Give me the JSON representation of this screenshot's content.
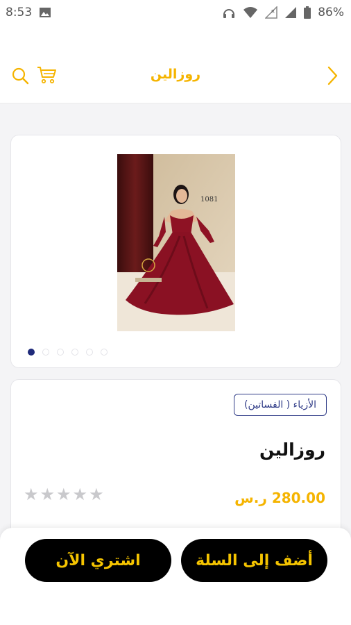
{
  "status_bar": {
    "time": "8:53",
    "battery": "86%",
    "icons": [
      "image-icon",
      "headphones-icon",
      "wifi-icon",
      "signal-r-icon",
      "signal-icon",
      "battery-icon"
    ]
  },
  "app_bar": {
    "title": "روزالين",
    "icons": [
      "search-icon",
      "cart-icon",
      "chevron-right-icon"
    ],
    "accent_color": "#f5b400"
  },
  "gallery": {
    "photo_label": "1081",
    "image_count": 6,
    "active_index": 0
  },
  "product": {
    "category": "الأزياء ( الفساتين)",
    "name": "روزالين",
    "price": "280.00 ر.س",
    "rating_stars": 5,
    "rating_value": 0
  },
  "actions": {
    "buy_now": "اشتري الآن",
    "add_to_cart": "أضف إلى السلة"
  },
  "colors": {
    "accent": "#f5b400",
    "badge": "#2e3a86",
    "button_bg": "#000000"
  }
}
